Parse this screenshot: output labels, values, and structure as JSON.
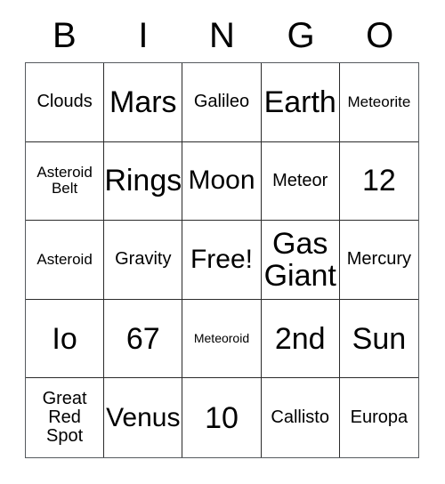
{
  "card": {
    "type": "bingo-card",
    "title_letters": [
      "B",
      "I",
      "N",
      "G",
      "O"
    ],
    "columns": 5,
    "rows": 5,
    "free_space_label": "Free!",
    "free_space_position": [
      2,
      2
    ],
    "colors": {
      "background": "#ffffff",
      "text": "#000000",
      "grid_line": "#2b2b2b",
      "outer_border": "#555a5e"
    },
    "cells": [
      {
        "text": "Clouds",
        "size": "fs-m"
      },
      {
        "text": "Mars",
        "size": "fs-xxl"
      },
      {
        "text": "Galileo",
        "size": "fs-m"
      },
      {
        "text": "Earth",
        "size": "fs-xxl"
      },
      {
        "text": "Meteorite",
        "size": "fs-s"
      },
      {
        "text": "Asteroid\nBelt",
        "size": "fs-s"
      },
      {
        "text": "Rings",
        "size": "fs-xxl"
      },
      {
        "text": "Moon",
        "size": "fs-xl"
      },
      {
        "text": "Meteor",
        "size": "fs-m"
      },
      {
        "text": "12",
        "size": "fs-xxl"
      },
      {
        "text": "Asteroid",
        "size": "fs-s"
      },
      {
        "text": "Gravity",
        "size": "fs-m"
      },
      {
        "text": "Free!",
        "size": "fs-xl"
      },
      {
        "text": "Gas\nGiant",
        "size": "fs-xxl"
      },
      {
        "text": "Mercury",
        "size": "fs-m"
      },
      {
        "text": "Io",
        "size": "fs-xxl"
      },
      {
        "text": "67",
        "size": "fs-xxl"
      },
      {
        "text": "Meteoroid",
        "size": "fs-xs"
      },
      {
        "text": "2nd",
        "size": "fs-xxl"
      },
      {
        "text": "Sun",
        "size": "fs-xxl"
      },
      {
        "text": "Great\nRed\nSpot",
        "size": "fs-m"
      },
      {
        "text": "Venus",
        "size": "fs-xl"
      },
      {
        "text": "10",
        "size": "fs-xxl"
      },
      {
        "text": "Callisto",
        "size": "fs-m"
      },
      {
        "text": "Europa",
        "size": "fs-m"
      }
    ]
  }
}
